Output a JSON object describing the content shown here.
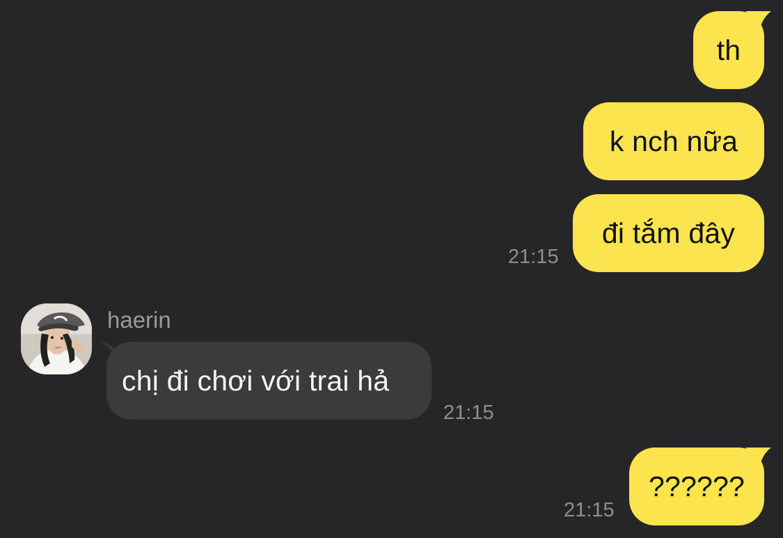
{
  "conversation": {
    "messages": [
      {
        "sender": "me",
        "text": "th"
      },
      {
        "sender": "me",
        "text": "k nch nữa"
      },
      {
        "sender": "me",
        "text": "đi tắm đây",
        "time": "21:15"
      },
      {
        "sender": "haerin",
        "sender_name": "haerin",
        "text": "chị đi chơi với trai hả",
        "time": "21:15"
      },
      {
        "sender": "me",
        "text": "??????",
        "time": "21:15"
      }
    ]
  },
  "colors": {
    "background": "#262628",
    "my_bubble": "#fbe44e",
    "their_bubble": "#3b3b3d",
    "timestamp": "#8f8f91"
  },
  "icons": {
    "avatar": "haerin-avatar-photo"
  }
}
